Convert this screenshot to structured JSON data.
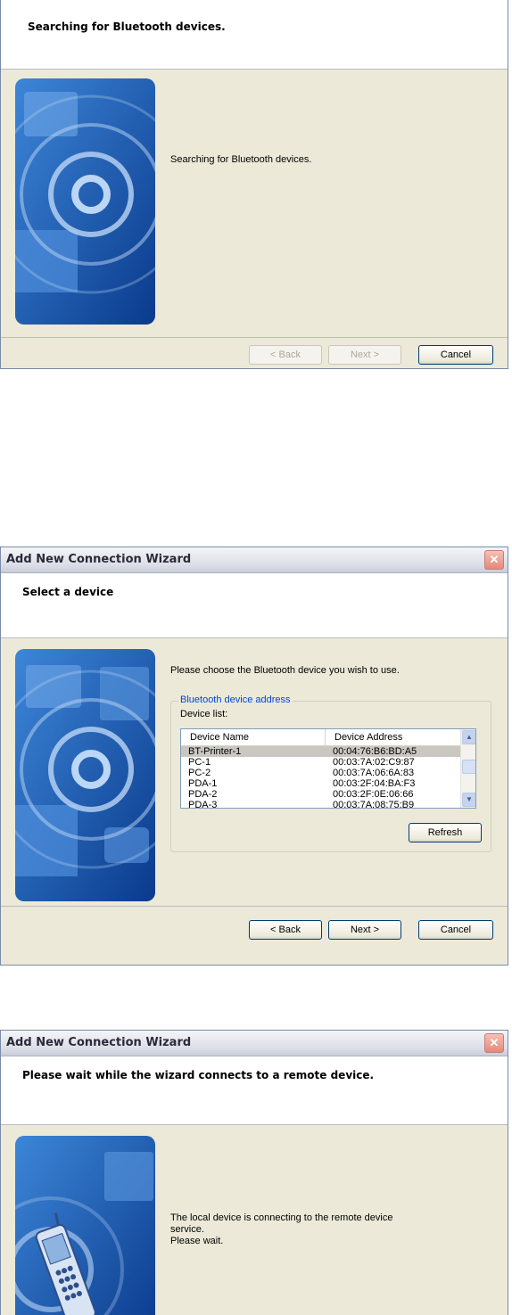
{
  "colors": {
    "art_dark": "#0a3a8c",
    "art_light": "#3d86d8",
    "link_blue": "#0046d5"
  },
  "dialog1": {
    "header_title": "Searching for Bluetooth devices.",
    "message": "Searching for Bluetooth devices.",
    "buttons": {
      "back": "< Back",
      "next": "Next >",
      "cancel": "Cancel"
    }
  },
  "dialog2": {
    "window_title": "Add New Connection Wizard",
    "header_title": "Select a device",
    "instruction": "Please choose the Bluetooth device you wish to use.",
    "group_label": "Bluetooth device address",
    "list_label": "Device list:",
    "columns": [
      "Device Name",
      "Device Address"
    ],
    "devices": [
      {
        "name": "BT-Printer-1",
        "address": "00:04:76:B6:BD:A5",
        "selected": true
      },
      {
        "name": "PC-1",
        "address": "00:03:7A:02:C9:87"
      },
      {
        "name": "PC-2",
        "address": "00:03:7A:06:6A:83"
      },
      {
        "name": "PDA-1",
        "address": "00:03:2F:04:BA:F3"
      },
      {
        "name": "PDA-2",
        "address": "00:03:2F:0E:06:66"
      },
      {
        "name": "PDA-3",
        "address": "00:03:7A:08:75:B9"
      }
    ],
    "refresh": "Refresh",
    "buttons": {
      "back": "< Back",
      "next": "Next >",
      "cancel": "Cancel"
    }
  },
  "dialog3": {
    "window_title": "Add New Connection Wizard",
    "header_title": "Please wait while the wizard connects to a remote device.",
    "message": "The local device is connecting to the remote device\nservice.\nPlease wait."
  }
}
